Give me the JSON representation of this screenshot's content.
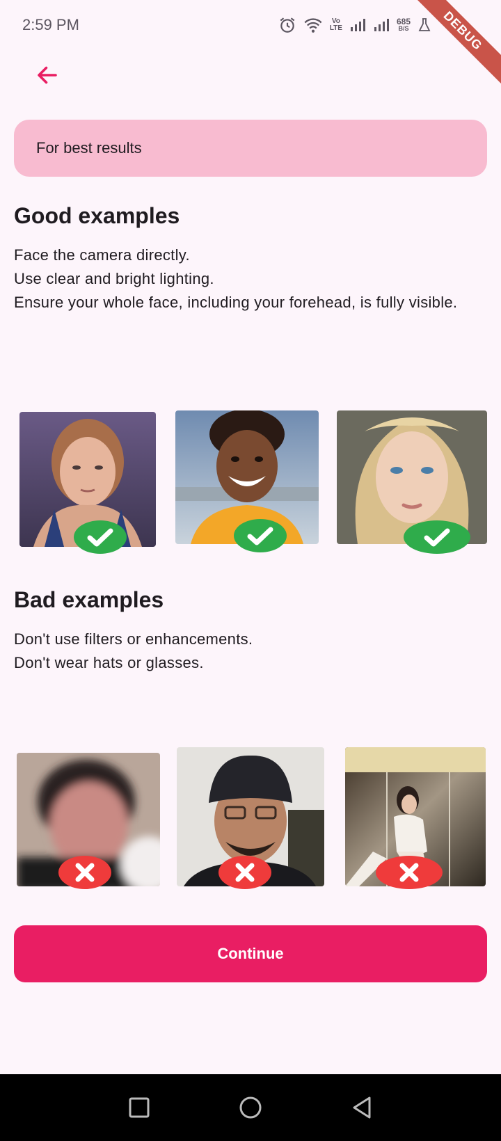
{
  "status_bar": {
    "time": "2:59 PM",
    "network_speed_value": "685",
    "network_speed_unit": "B/S",
    "volte_top": "Vo",
    "volte_bottom": "LTE"
  },
  "debug_banner": "DEBUG",
  "info_banner": {
    "text": "For best results"
  },
  "good_section": {
    "title": "Good examples",
    "lines": [
      "Face the camera directly.",
      "Use clear and bright lighting.",
      "Ensure your whole face, including your forehead, is fully visible."
    ]
  },
  "bad_section": {
    "title": "Bad examples",
    "lines": [
      "Don't use filters or enhancements.",
      "Don't wear hats or glasses."
    ]
  },
  "continue_button": {
    "label": "Continue"
  },
  "colors": {
    "accent": "#e91e63",
    "banner": "#f8bbd0",
    "background": "#fdf5fb",
    "good_badge": "#2fac4b",
    "bad_badge": "#ef3b3b"
  },
  "icons": {
    "back": "arrow-left-icon",
    "good": "check-icon",
    "bad": "x-icon",
    "nav": [
      "square-icon",
      "circle-icon",
      "triangle-back-icon"
    ]
  }
}
